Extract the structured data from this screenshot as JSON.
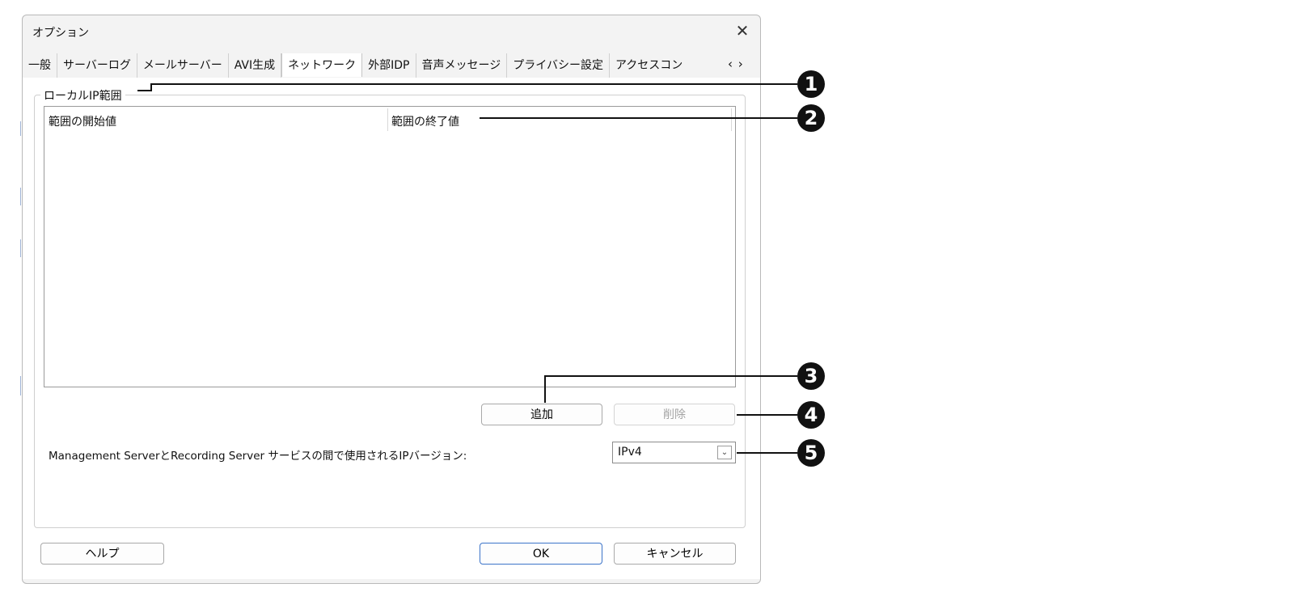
{
  "dialog": {
    "title": "オプション",
    "close_glyph": "✕"
  },
  "tabs": [
    {
      "label": "一般",
      "active": false
    },
    {
      "label": "サーバーログ",
      "active": false
    },
    {
      "label": "メールサーバー",
      "active": false
    },
    {
      "label": "AVI生成",
      "active": false
    },
    {
      "label": "ネットワーク",
      "active": true
    },
    {
      "label": "外部IDP",
      "active": false
    },
    {
      "label": "音声メッセージ",
      "active": false
    },
    {
      "label": "プライバシー設定",
      "active": false
    },
    {
      "label": "アクセスコン",
      "active": false
    }
  ],
  "tab_scroll_glyph": "‹ ›",
  "group": {
    "label": "ローカルIP範囲",
    "columns": [
      "範囲の開始値",
      "範囲の終了値"
    ],
    "rows": []
  },
  "buttons": {
    "add": "追加",
    "delete": "削除",
    "help": "ヘルプ",
    "ok": "OK",
    "cancel": "キャンセル"
  },
  "ip_version": {
    "label": "Management ServerとRecording Server サービスの間で使用されるIPバージョン:",
    "selected": "IPv4",
    "arrow_icon": "chevron-down-icon"
  },
  "callouts": [
    "1",
    "2",
    "3",
    "4",
    "5"
  ],
  "colors": {
    "default_button_border": "#3c74c9",
    "callout": "#111111"
  }
}
